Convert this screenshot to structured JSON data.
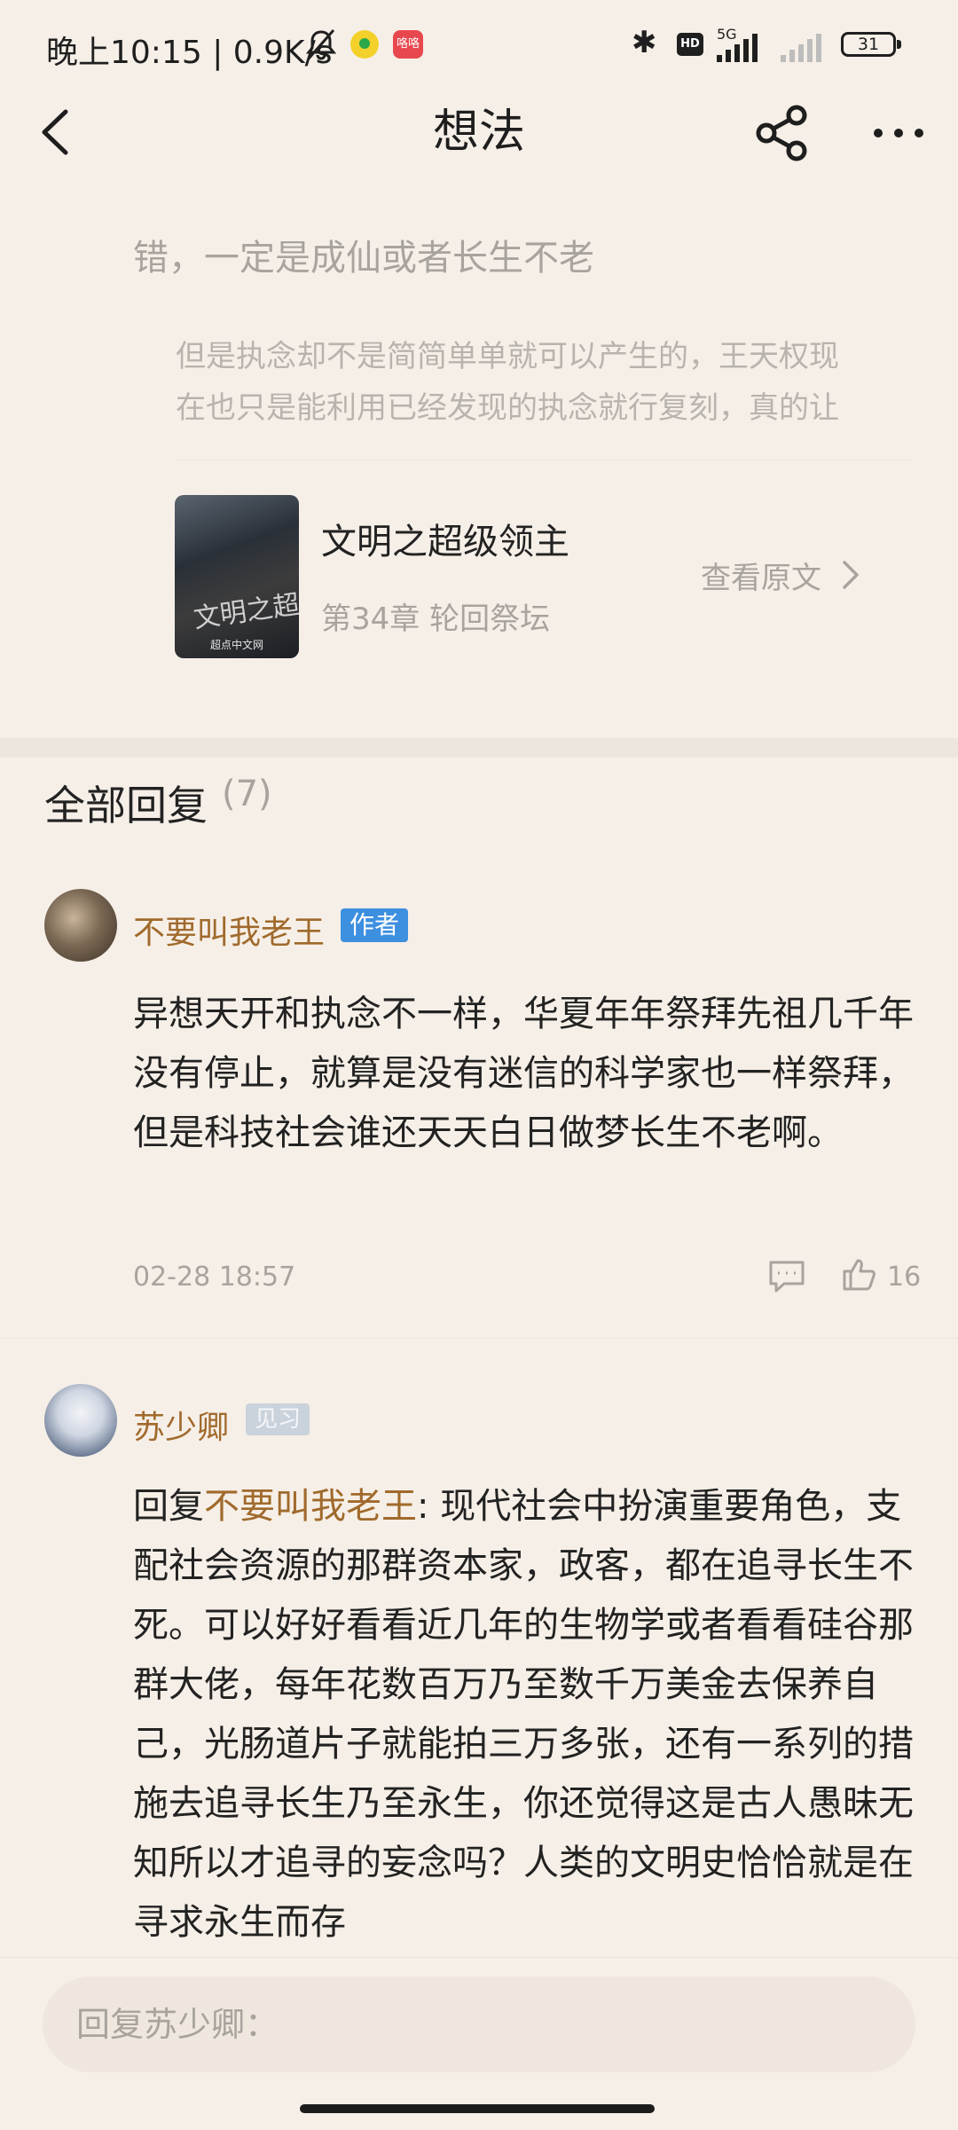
{
  "status_bar": {
    "time_net": "晚上10:15 | 0.9K/s",
    "app2_label": "咯咯",
    "bluetooth": "✱",
    "hd": "HD",
    "network": "5G",
    "battery": "31"
  },
  "header": {
    "title": "想法"
  },
  "thought": {
    "text": "错，一定是成仙或者长生不老",
    "quote_line1": "但是执念却不是简简单单就可以产生的，王天权现",
    "quote_line2": "在也只是能利用已经发现的执念就行复刻，真的让"
  },
  "book": {
    "cover_title": "文明之超级领主",
    "cover_publisher": "超点中文网",
    "title": "文明之超级领主",
    "chapter": "第34章 轮回祭坛",
    "view_original": "查看原文"
  },
  "replies": {
    "heading": "全部回复",
    "count": "(7)"
  },
  "comments": [
    {
      "username": "不要叫我老王",
      "badge": "作者",
      "text": "异想天开和执念不一样，华夏年年祭拜先祖几千年没有停止，就算是没有迷信的科学家也一样祭拜，但是科技社会谁还天天白日做梦长生不老啊。",
      "time": "02-28 18:57",
      "likes": "16"
    },
    {
      "username": "苏少卿",
      "badge": "见习",
      "reply_prefix": "回复",
      "reply_to": "不要叫我老王",
      "text": ": 现代社会中扮演重要角色，支配社会资源的那群资本家，政客，都在追寻长生不死。可以好好看看近几年的生物学或者看看硅谷那群大佬，每年花数百万乃至数千万美金去保养自己，光肠道片子就能拍三万多张，还有一系列的措施去追寻长生乃至永生，你还觉得这是古人愚昧无知所以才追寻的妄念吗？人类的文明史恰恰就是在寻求永生而存"
    }
  ],
  "reply_input": {
    "placeholder": "回复苏少卿："
  },
  "colors": {
    "background": "#f6efe7",
    "username": "#a06a2c",
    "author_badge": "#3d8fe0",
    "muted_text": "#a8a39d"
  },
  "icons": [
    "back-chevron-icon",
    "share-icon",
    "more-icon",
    "chevron-right-icon",
    "comment-reply-icon",
    "thumbs-up-icon",
    "mute-bell-icon",
    "signal-icon"
  ]
}
